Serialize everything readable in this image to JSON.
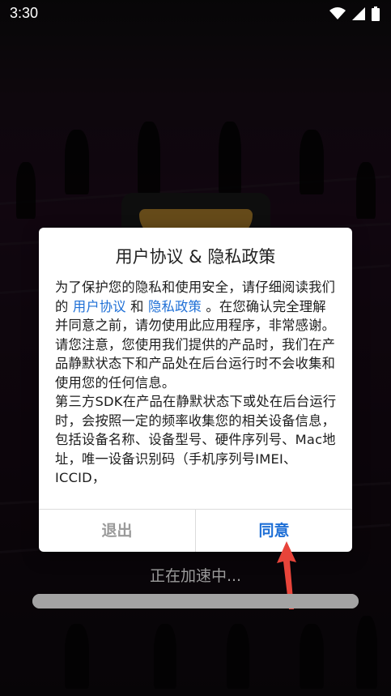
{
  "status_bar": {
    "time": "3:30",
    "icons": [
      "wifi-icon",
      "signal-icon",
      "battery-icon"
    ]
  },
  "dialog": {
    "title": "用户协议 & 隐私政策",
    "body": {
      "intro_before": "为了保护您的隐私和使用安全，请仔细阅读我们的 ",
      "link_user_agreement": "用户协议",
      "connector": " 和 ",
      "link_privacy_policy": "隐私政策",
      "intro_after": " 。在您确认完全理解并同意之前，请勿使用此应用程序，非常感谢。",
      "paragraph_2": "请您注意，您使用我们提供的产品时，我们在产品静默状态下和产品处在后台运行时不会收集和使用您的任何信息。",
      "paragraph_3": "第三方SDK在产品在静默状态下或处在后台运行时，会按照一定的频率收集您的相关设备信息，包括设备名称、设备型号、硬件序列号、Mac地址，唯一设备识别码（手机序列号IMEI、ICCID，"
    },
    "buttons": {
      "exit": "退出",
      "agree": "同意"
    }
  },
  "loading": {
    "text": "正在加速中...",
    "progress": 1.0
  },
  "colors": {
    "link": "#1e6fd6",
    "agree": "#1e6fd6",
    "exit": "#9a9a9a",
    "annotation_arrow": "#e8443a"
  }
}
